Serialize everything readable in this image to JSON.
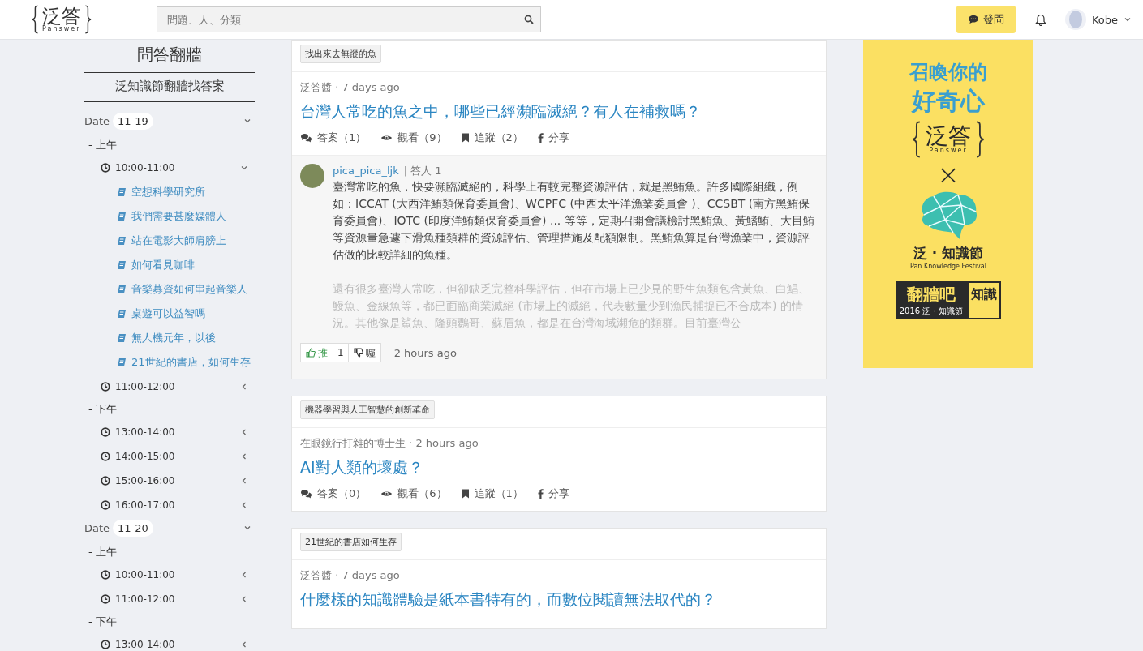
{
  "header": {
    "logo": {
      "mark": "泛答",
      "sub": "Panswer"
    },
    "search": {
      "placeholder": "問題、人、分類"
    },
    "ask_button": "發問",
    "user": {
      "name": "Kobe"
    }
  },
  "sidebar": {
    "title": "問答翻牆",
    "subtitle": "泛知識節翻牆找答案",
    "dates": [
      {
        "label": "Date",
        "value": "11-19",
        "expanded": true,
        "children": [
          {
            "label": "- 上午",
            "children": [
              {
                "time": "10:00-11:00",
                "expanded": true,
                "children": [
                  {
                    "title": "空想科學研究所"
                  },
                  {
                    "title": "我們需要甚麼媒體人"
                  },
                  {
                    "title": "站在電影大師肩膀上"
                  },
                  {
                    "title": "如何看見咖啡"
                  },
                  {
                    "title": "音樂募資如何串起音樂人"
                  },
                  {
                    "title": "桌遊可以益智嗎"
                  },
                  {
                    "title": "無人機元年，以後"
                  },
                  {
                    "title": "21世紀的書店，如何生存"
                  }
                ]
              },
              {
                "time": "11:00-12:00",
                "expanded": false
              }
            ]
          },
          {
            "label": "- 下午",
            "children": [
              {
                "time": "13:00-14:00",
                "expanded": false
              },
              {
                "time": "14:00-15:00",
                "expanded": false
              },
              {
                "time": "15:00-16:00",
                "expanded": false
              },
              {
                "time": "16:00-17:00",
                "expanded": false
              }
            ]
          }
        ]
      },
      {
        "label": "Date",
        "value": "11-20",
        "expanded": true,
        "children": [
          {
            "label": "- 上午",
            "children": [
              {
                "time": "10:00-11:00",
                "expanded": false
              },
              {
                "time": "11:00-12:00",
                "expanded": false
              }
            ]
          },
          {
            "label": "- 下午",
            "children": [
              {
                "time": "13:00-14:00",
                "expanded": false
              }
            ]
          }
        ]
      }
    ]
  },
  "questions": [
    {
      "tag": "找出來去無蹤的魚",
      "author": "泛答醬",
      "separator": "·",
      "time": "7 days ago",
      "title": "台灣人常吃的魚之中，哪些已經瀕臨滅絕？有人在補救嗎？",
      "stats": [
        {
          "kind": "comments",
          "label": "答案（1）"
        },
        {
          "kind": "eye",
          "label": "觀看（9）"
        },
        {
          "kind": "bookmark",
          "label": "追蹤（2）"
        },
        {
          "kind": "facebook",
          "label": "分享"
        }
      ],
      "answer": {
        "user": "pica_pica_ljk",
        "divider": "|",
        "role": "答人 1",
        "paragraphs": [
          "臺灣常吃的魚，快要瀕臨滅絕的，科學上有較完整資源評估，就是黑鮪魚。許多國際組織，例如：ICCAT (大西洋鮪類保育委員會)、WCPFC (中西太平洋漁業委員會 )、CCSBT (南方黑鮪保育委員會)、IOTC (印度洋鮪類保育委員會) ... 等等，定期召開會議檢討黑鮪魚、黃鰭鮪、大目鮪等資源量急遽下滑魚種類群的資源評估、管理措施及配額限制。黑鮪魚算是台灣漁業中，資源評估做的比較詳細的魚種。",
          "還有很多臺灣人常吃，但卻缺乏完整科學評估，但在市場上已少見的野生魚類包含黃魚、白鯧、鰻魚、金線魚等，都已面臨商業滅絕 (市場上的滅絕，代表數量少到漁民捕捉已不合成本) 的情況。其他像是鯊魚、隆頭鸚哥、蘇眉魚，都是在台灣海域瀕危的類群。目前臺灣公"
        ],
        "like": "推",
        "count": "1",
        "dislike": "噓",
        "time": "2 hours ago"
      }
    },
    {
      "tag": "機器學習與人工智慧的創新革命",
      "author": "在眼鏡行打雜的博士生",
      "separator": "·",
      "time": "2 hours ago",
      "title": "AI對人類的壞處？",
      "stats": [
        {
          "kind": "comments",
          "label": "答案（0）"
        },
        {
          "kind": "eye",
          "label": "觀看（6）"
        },
        {
          "kind": "bookmark",
          "label": "追蹤（1）"
        },
        {
          "kind": "facebook",
          "label": "分享"
        }
      ]
    },
    {
      "tag": "21世紀的書店如何生存",
      "author": "泛答醬",
      "separator": "·",
      "time": "7 days ago",
      "title": "什麼樣的知識體驗是紙本書特有的，而數位閱讀無法取代的？"
    }
  ],
  "banner": {
    "headline": [
      "召喚你的",
      "好奇心"
    ],
    "logo_mark": "泛答",
    "logo_sub": "Panswer",
    "times": "×",
    "festival": "泛 · 知識節",
    "festival_sub": "Pan Knowledge Festival",
    "book_title": "翻牆吧",
    "book_side": "知識",
    "book_year": "2016 泛・知識節"
  }
}
